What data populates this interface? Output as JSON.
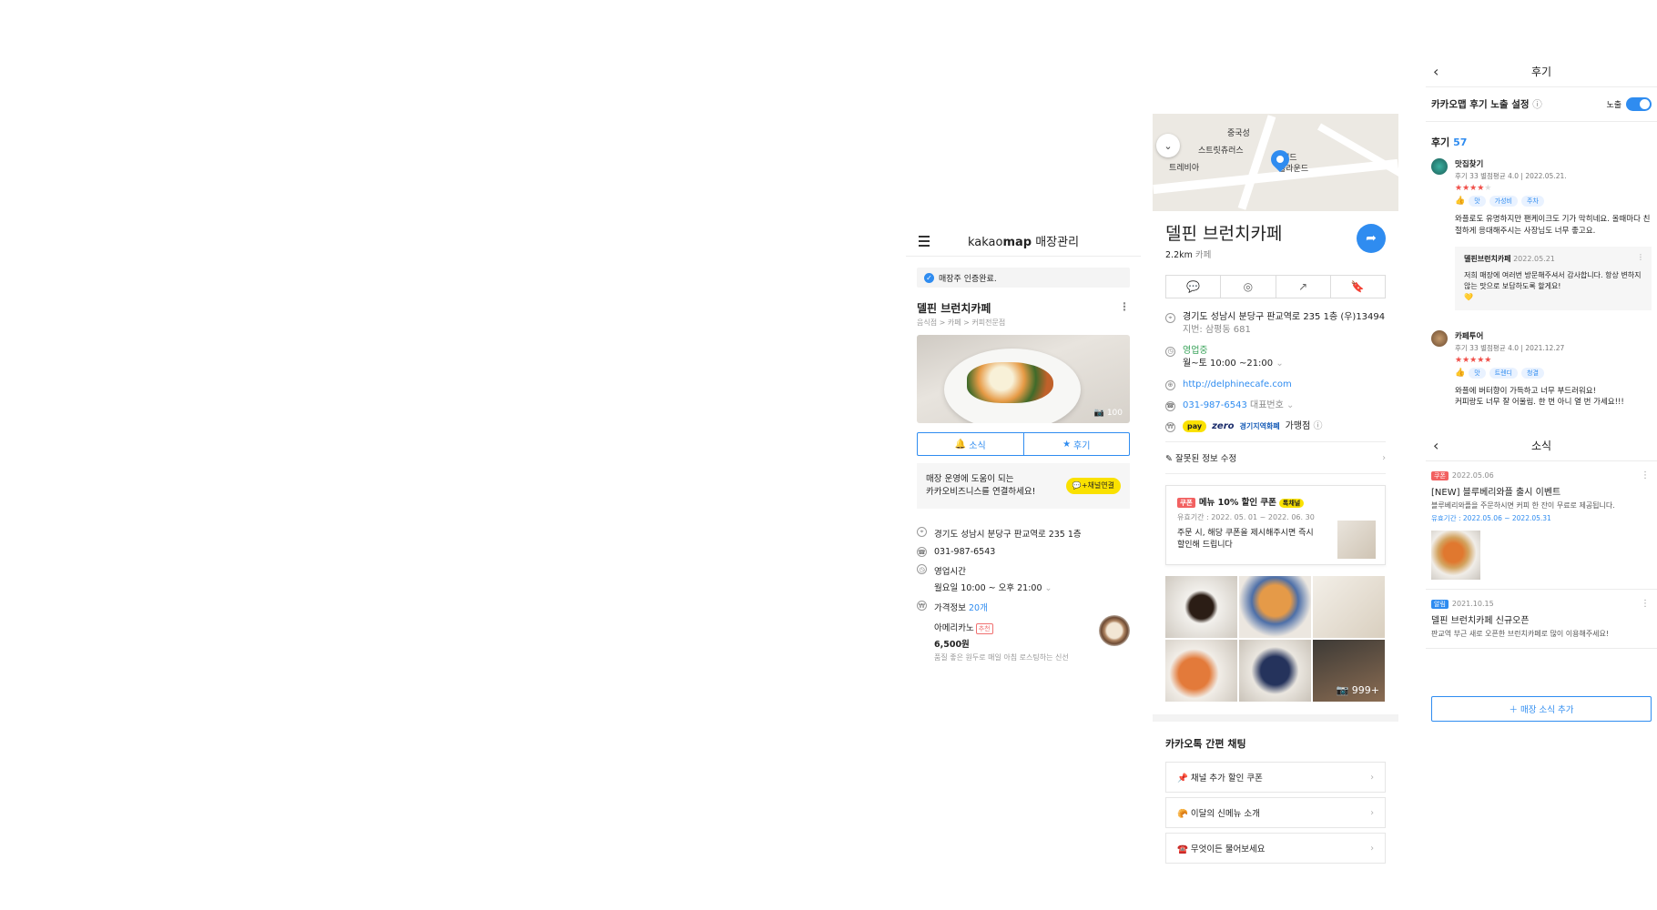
{
  "manage": {
    "logo_brand": "kakao",
    "logo_map": "map",
    "logo_suffix": " 매장관리",
    "verified": "매장주 인증완료.",
    "store_name": "델핀 브런치카페",
    "category": "음식점 > 카페 > 커피전문점",
    "photo_count": "100",
    "tab_news": "소식",
    "tab_review": "후기",
    "promo_line1": "매장 운영에 도움이 되는",
    "promo_line2": "카카오비즈니스를 연결하세요!",
    "promo_button": "채널연결",
    "address": "경기도 성남시 분당구 판교역로 235 1층",
    "phone": "031-987-6543",
    "hours_label": "영업시간",
    "hours_value": "월요일 10:00 ~ 오후 21:00",
    "price_label": "가격정보",
    "price_count": "20개",
    "menu_name": "아메리카노",
    "menu_badge": "추천",
    "menu_price": "6,500원",
    "menu_desc": "품질 좋은 원두로 매일 아침 로스팅하는 신선"
  },
  "place": {
    "map_labels": [
      "중국성",
      "스트릿츄러스",
      "트레비아",
      "텐드",
      "플라운드"
    ],
    "name": "델핀 브런치카페",
    "distance": "2.2km",
    "category": "카페",
    "address": "경기도 성남시 분당구 판교역로 235 1층 (우)13494",
    "jibun": "지번: 삼평동 681",
    "open_status": "영업중",
    "hours": "월~토 10:00 ~21:00",
    "url": "http://delphinecafe.com",
    "phone": "031-987-6543",
    "phone_label": "대표번호",
    "pay": "pay",
    "zero": "zero",
    "gg": "경기지역화폐",
    "merchant": "가맹점",
    "edit": "잘못된 정보 수정",
    "coupon_tag": "쿠폰",
    "coupon_title": "메뉴 10% 할인 쿠폰",
    "coupon_channel": "톡채널",
    "coupon_period": "유효기간 : 2022. 05. 01 ~ 2022. 06. 30",
    "coupon_desc1": "주문 시, 해당 쿠폰을 제시해주시면 즉시",
    "coupon_desc2": "할인해 드립니다",
    "photo_more": "999+",
    "chat_title": "카카오톡 간편 채팅",
    "chat_items": [
      "📌 채널 추가 할인 쿠폰",
      "🥐 이달의 신메뉴 소개",
      "☎️ 무엇이든 물어보세요"
    ]
  },
  "reviews": {
    "header": "후기",
    "setting_label": "카카오맵 후기 노출 설정",
    "toggle_label": "노출",
    "count_label": "후기",
    "count": "57",
    "items": [
      {
        "name": "맛집찾기",
        "meta": "후기 33  별점평균 4.0  |  2022.05.21.",
        "rating": 4,
        "chips": [
          "맛",
          "가성비",
          "주차"
        ],
        "text": "와플로도 유명하지만 팬케이크도 기가 막히네요. 올때마다 친절하게 응대해주시는 사장님도 너무 좋고요.",
        "reply_name": "델핀브런치카페",
        "reply_date": "2022.05.21",
        "reply_text": "저희 매장에 여러번 방문해주셔서 감사합니다. 항상 변하지 않는 맛으로 보답하도록 할게요!",
        "reply_emoji": "💛"
      },
      {
        "name": "카페투어",
        "meta": "후기 33  별점평균 4.0  |  2021.12.27",
        "rating": 5,
        "chips": [
          "맛",
          "트렌디",
          "청결"
        ],
        "text1": "와플에 버터향이 가득하고 너무 부드러워요!",
        "text2": "커피랑도 너무 잘 어울림. 한 번 아니 열 번 가세요!!!"
      }
    ],
    "news_header": "소식",
    "news": [
      {
        "tag": "쿠폰",
        "tag_color": "#f26161",
        "date": "2022.05.06",
        "title": "[NEW] 블루베리와플 출시 이벤트",
        "desc": "블루베리와플을 주문하시면 커피 한 잔이 무료로 제공됩니다.",
        "valid": "유효기간 : 2022.05.06 ~ 2022.05.31"
      },
      {
        "tag": "알림",
        "tag_color": "#2f8cf0",
        "date": "2021.10.15",
        "title": "델핀 브런치카페 신규오픈",
        "desc": "판교역 부근 새로 오픈한 브런치카페로 많이 이용해주세요!"
      }
    ],
    "add_button": "매장 소식 추가"
  }
}
